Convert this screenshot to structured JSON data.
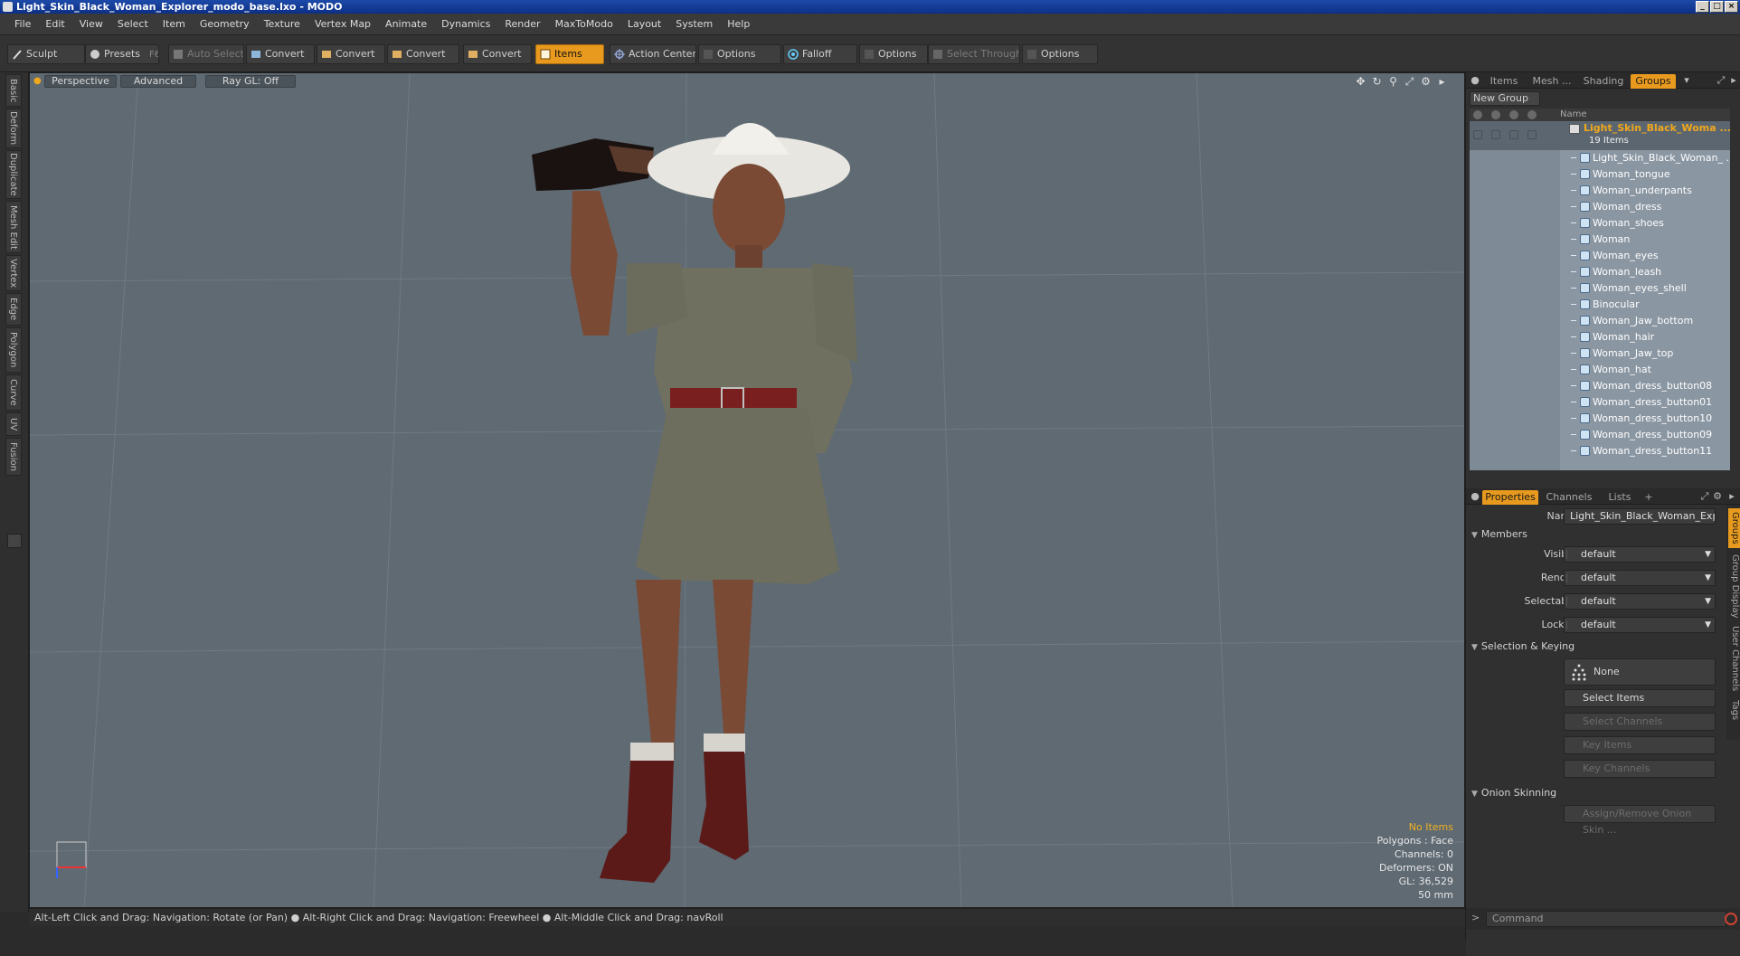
{
  "window": {
    "title": "Light_Skin_Black_Woman_Explorer_modo_base.lxo - MODO",
    "min": "_",
    "max": "□",
    "close": "×"
  },
  "menu": [
    "File",
    "Edit",
    "View",
    "Select",
    "Item",
    "Geometry",
    "Texture",
    "Vertex Map",
    "Animate",
    "Dynamics",
    "Render",
    "MaxToModo",
    "Layout",
    "System",
    "Help"
  ],
  "toolbar": {
    "sculpt": "Sculpt",
    "presets": "Presets",
    "presets_shortcut": "F6",
    "auto_select": "Auto Select",
    "convert1": "Convert",
    "convert2": "Convert",
    "convert3": "Convert",
    "convert4": "Convert",
    "items": "Items",
    "action_center": "Action Center",
    "options1": "Options",
    "falloff": "Falloff",
    "options2": "Options",
    "select_through": "Select Through",
    "options3": "Options"
  },
  "left_tabs": [
    "Basic",
    "Deform",
    "Duplicate",
    "Mesh Edit",
    "Vertex",
    "Edge",
    "Polygon",
    "Curve",
    "UV",
    "Fusion"
  ],
  "viewport": {
    "perspective": "Perspective",
    "advanced": "Advanced",
    "raygl": "Ray GL: Off",
    "info": {
      "no_items": "No Items",
      "polygons": "Polygons : Face",
      "channels": "Channels: 0",
      "deformers": "Deformers: ON",
      "gl": "GL: 36,529",
      "focal": "50 mm"
    }
  },
  "status": "Alt-Left Click and Drag: Navigation: Rotate (or Pan) ● Alt-Right Click and Drag: Navigation: Freewheel ● Alt-Middle Click and Drag: navRoll",
  "top_panel_tabs": [
    "Items",
    "Mesh ...",
    "Shading",
    "Groups"
  ],
  "groups": {
    "new_group": "New Group",
    "name_header": "Name",
    "group_name": "Light_Skin_Black_Woma ...",
    "group_count": "19 Items",
    "items": [
      "Light_Skin_Black_Woman_ ...",
      "Woman_tongue",
      "Woman_underpants",
      "Woman_dress",
      "Woman_shoes",
      "Woman",
      "Woman_eyes",
      "Woman_leash",
      "Woman_eyes_shell",
      "Binocular",
      "Woman_Jaw_bottom",
      "Woman_hair",
      "Woman_Jaw_top",
      "Woman_hat",
      "Woman_dress_button08",
      "Woman_dress_button01",
      "Woman_dress_button10",
      "Woman_dress_button09",
      "Woman_dress_button11"
    ]
  },
  "bottom_panel_tabs": [
    "Properties",
    "Channels",
    "Lists",
    "+"
  ],
  "properties": {
    "name_label": "Name",
    "name_value": "Light_Skin_Black_Woman_Explor",
    "members": "Members",
    "visible_label": "Visible",
    "visible_value": "default",
    "render_label": "Render",
    "render_value": "default",
    "selectable_label": "Selectable",
    "selectable_value": "default",
    "locked_label": "Locked",
    "locked_value": "default",
    "selection_keying": "Selection & Keying",
    "none": "None",
    "select_items": "Select Items",
    "select_channels": "Select Channels",
    "key_items": "Key Items",
    "key_channels": "Key Channels",
    "onion_skinning": "Onion Skinning",
    "assign_onion": "Assign/Remove Onion Skin ..."
  },
  "right_vtabs": [
    "Groups",
    "Group Display",
    "User Channels",
    "Tags"
  ],
  "command": {
    "prompt": ">",
    "placeholder": "Command"
  },
  "colors": {
    "accent": "#e89a1e",
    "viewport_bg": "#5f6a73"
  }
}
